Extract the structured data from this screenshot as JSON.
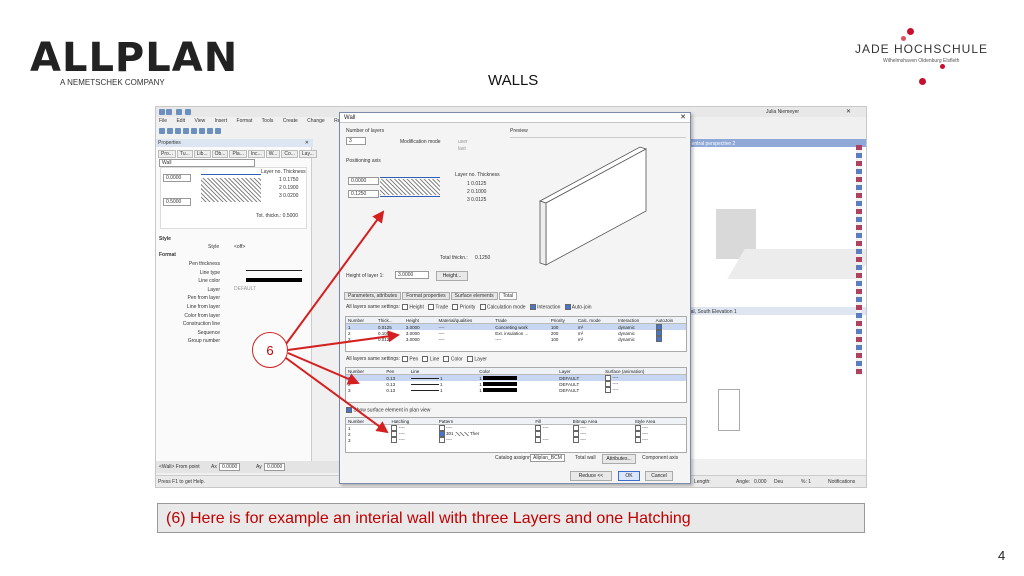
{
  "slide": {
    "logo_left_main": "ALLPLAN",
    "logo_left_sub": "A NEMETSCHEK COMPANY",
    "logo_right_main": "JADE HOCHSCHULE",
    "logo_right_sub": "Wilhelmshaven Oldenburg Elsfleth",
    "title": "WALLS",
    "caption": "(6) Here is for example an interial wall with three Layers and one Hatching",
    "page_number": "4",
    "callout_number": "6",
    "accent_color": "#d42020"
  },
  "app": {
    "user_name": "Julia Niemeyer",
    "menu": [
      "File",
      "Edit",
      "View",
      "Insert",
      "Format",
      "Tools",
      "Create",
      "Change",
      "Repeat"
    ],
    "properties_title": "Properties",
    "properties_tabs": [
      "Pro...",
      "Tu...",
      "Lib...",
      "Ob...",
      "Pla...",
      "Inc...",
      "W...",
      "Co...",
      "Lay..."
    ],
    "properties_filter": "Wall",
    "layer_header": "Layer no.   Thickness",
    "layers_mini": [
      {
        "no": "1",
        "thickness": "0.1750"
      },
      {
        "no": "2",
        "thickness": "0.1900"
      },
      {
        "no": "3",
        "thickness": "0.0200"
      }
    ],
    "mini_values": [
      "0.0000",
      "0.5000"
    ],
    "total_thickness": "Tot. thickn.:  0.5000",
    "style_section": "Style",
    "style_label": "Style",
    "style_value": "<off>",
    "format_section": "Format",
    "format_rows": [
      "Pen thickness",
      "Line type",
      "Line color",
      "Layer",
      "Pen from layer",
      "Line from layer",
      "Color from layer",
      "Construction line",
      "Sequence",
      "Group number"
    ],
    "layer_value": "DEFAULT",
    "bottom_tool": "<Wall> From point",
    "ax_label": "Ax",
    "ax_value": "0.0000",
    "ay_label": "Ay",
    "ay_value": "0.0000",
    "status_text": "Press F1 to get Help.",
    "status_length": "Length: ",
    "status_angle_label": "Angle:",
    "status_angle": "0.000",
    "status_deg": "Deu",
    "status_pct": "%: 1",
    "notifications": "Notifications",
    "view_title": "Central perspective 2",
    "view_label_2": "nal, South Elevation 1"
  },
  "dialog": {
    "title": "Wall",
    "number_of_layers_label": "Number of layers",
    "number_of_layers_value": "3",
    "modification_mode_label": "Modification mode",
    "mode_options": [
      "user",
      "last"
    ],
    "positioning_axis_label": "Positioning axis",
    "preview_label": "Preview",
    "axis_values": [
      "0.0000",
      "0.1250"
    ],
    "layer_no_header": "Layer no.  Thickness",
    "layers": [
      {
        "no": "1",
        "thickness": "0.0125"
      },
      {
        "no": "2",
        "thickness": "0.1000"
      },
      {
        "no": "3",
        "thickness": "0.0125"
      }
    ],
    "total_thickness_label": "Total thickn.:",
    "total_thickness_value": "0.1250",
    "height_label": "Height of layer 1:",
    "height_value": "3.0000",
    "height_button": "Height...",
    "tabs": [
      "Parameters, attributes",
      "Format properties",
      "Surface elements",
      "Total"
    ],
    "active_tab": "Total",
    "same_settings_1": "All layers same settings:",
    "settings_1_options": [
      "Height",
      "Trade",
      "Priority",
      "Calculation mode",
      "Interaction",
      "Auto-join"
    ],
    "table1": {
      "headers": [
        "Number",
        "Thick...",
        "Height",
        "",
        "Material/qualities",
        "Trade",
        "Priority",
        "Calc. mode",
        "Interaction",
        "AutoJoin"
      ],
      "rows": [
        [
          "1",
          "0.0125",
          "3.0000",
          "",
          "----",
          "Concreting work",
          "100",
          "m²",
          "dynamic",
          ""
        ],
        [
          "2",
          "0.1000",
          "3.0000",
          "",
          "----",
          "Ext. insulation ...",
          "200",
          "m²",
          "dynamic",
          ""
        ],
        [
          "3",
          "0.0125",
          "3.0000",
          "",
          "----",
          "----",
          "100",
          "m²",
          "dynamic",
          ""
        ]
      ]
    },
    "same_settings_2": "All layers same settings:",
    "settings_2_options": [
      "Pen",
      "Line",
      "Color",
      "Layer"
    ],
    "table2": {
      "headers": [
        "Number",
        "Pen",
        "Line",
        "Color",
        "Layer",
        "Surface (animation)"
      ],
      "rows": [
        [
          "1",
          "0.13",
          "1",
          "1",
          "DEFAULT",
          "----"
        ],
        [
          "2",
          "0.13",
          "1",
          "1",
          "DEFAULT",
          "----"
        ],
        [
          "3",
          "0.13",
          "1",
          "1",
          "DEFAULT",
          "----"
        ]
      ]
    },
    "show_surface_label": "Show surface element in plan view",
    "table3": {
      "headers": [
        "Number",
        "Hatching",
        "Pattern",
        "Fill",
        "Bitmap Area",
        "Style Area"
      ],
      "rows": [
        [
          "1",
          "----",
          "----",
          "----",
          "----",
          "----"
        ],
        [
          "2",
          "----",
          "301",
          "Ther",
          "----",
          "----"
        ],
        [
          "3",
          "----",
          "----",
          "----",
          "----",
          "----"
        ]
      ]
    },
    "catalog_assignment_label": "Catalog assignment",
    "catalog_value": "Allplan_BCM",
    "total_wall_label": "Total wall",
    "attributes_button": "Attributes...",
    "component_axis_label": "Component axis",
    "reduce_button": "Reduce <<",
    "ok_button": "OK",
    "cancel_button": "Cancel"
  }
}
